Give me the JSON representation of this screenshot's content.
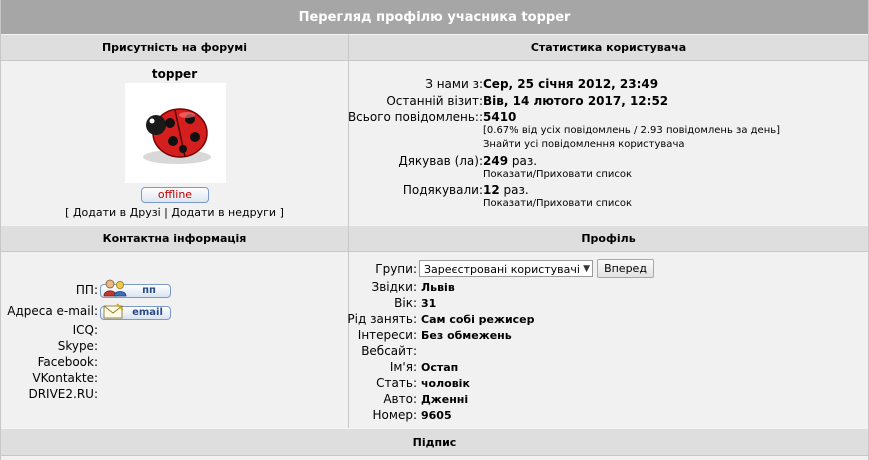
{
  "title": "Перегляд профілю учасника topper",
  "presence": {
    "header": "Присутність на форумі",
    "username": "topper",
    "status": "offline",
    "bracket_open": "[",
    "add_friend": "Додати в Друзі",
    "separator": "|",
    "add_foe": "Додати в недруги",
    "bracket_close": "]"
  },
  "stats": {
    "header": "Статистика користувача",
    "joined_label": "З нами з:",
    "joined_value": "Сер, 25 січня 2012, 23:49",
    "last_visit_label": "Останній візит:",
    "last_visit_value": "Вів, 14 лютого 2017, 12:52",
    "posts_label": "Всього повідомлень::",
    "posts_value": "5410",
    "posts_detail": "[0.67% від усіх повідомлень / 2.93 повідомлень за день]",
    "find_posts": "Знайти усі повідомлення користувача",
    "thanked_label": "Дякував (ла):",
    "thanked_count": "249",
    "thanked_unit": "раз.",
    "toggle_list_1": "Показати/Приховати список",
    "thanks_received_label": "Подякували:",
    "thanks_received_count": "12",
    "thanks_received_unit": "раз.",
    "toggle_list_2": "Показати/Приховати список"
  },
  "contact": {
    "header": "Контактна інформація",
    "pm_label": "ПП:",
    "pm_button": "пп",
    "email_label": "Адреса e-mail:",
    "email_button": "email",
    "icq_label": "ICQ:",
    "skype_label": "Skype:",
    "facebook_label": "Facebook:",
    "vkontakte_label": "VKontakte:",
    "drive2_label": "DRIVE2.RU:"
  },
  "profile": {
    "header": "Профіль",
    "groups_label": "Групи:",
    "groups_selected": "Зареєстровані користувачі",
    "go_button": "Вперед",
    "location_label": "Звідки:",
    "location_value": "Львів",
    "age_label": "Вік:",
    "age_value": "31",
    "occupation_label": "Рід занять:",
    "occupation_value": "Сам собі режисер",
    "interests_label": "Інтереси:",
    "interests_value": "Без обмежень",
    "website_label": "Вебсайт:",
    "name_label": "Ім'я:",
    "name_value": "Остап",
    "sex_label": "Стать:",
    "sex_value": "чоловік",
    "car_label": "Авто:",
    "car_value": "Дженні",
    "number_label": "Номер:",
    "number_value": "9605"
  },
  "signature": {
    "header": "Підпис"
  },
  "icons": {
    "avatar": "ladybug-icon",
    "pm": "users-icon",
    "email": "envelope-icon",
    "dropdown": "chevron-down-icon"
  },
  "colors": {
    "title_bg": "#a6a6a6",
    "header_bg": "#dedede",
    "cell_bg": "#f1f1f1",
    "offline_text": "#c00000"
  }
}
